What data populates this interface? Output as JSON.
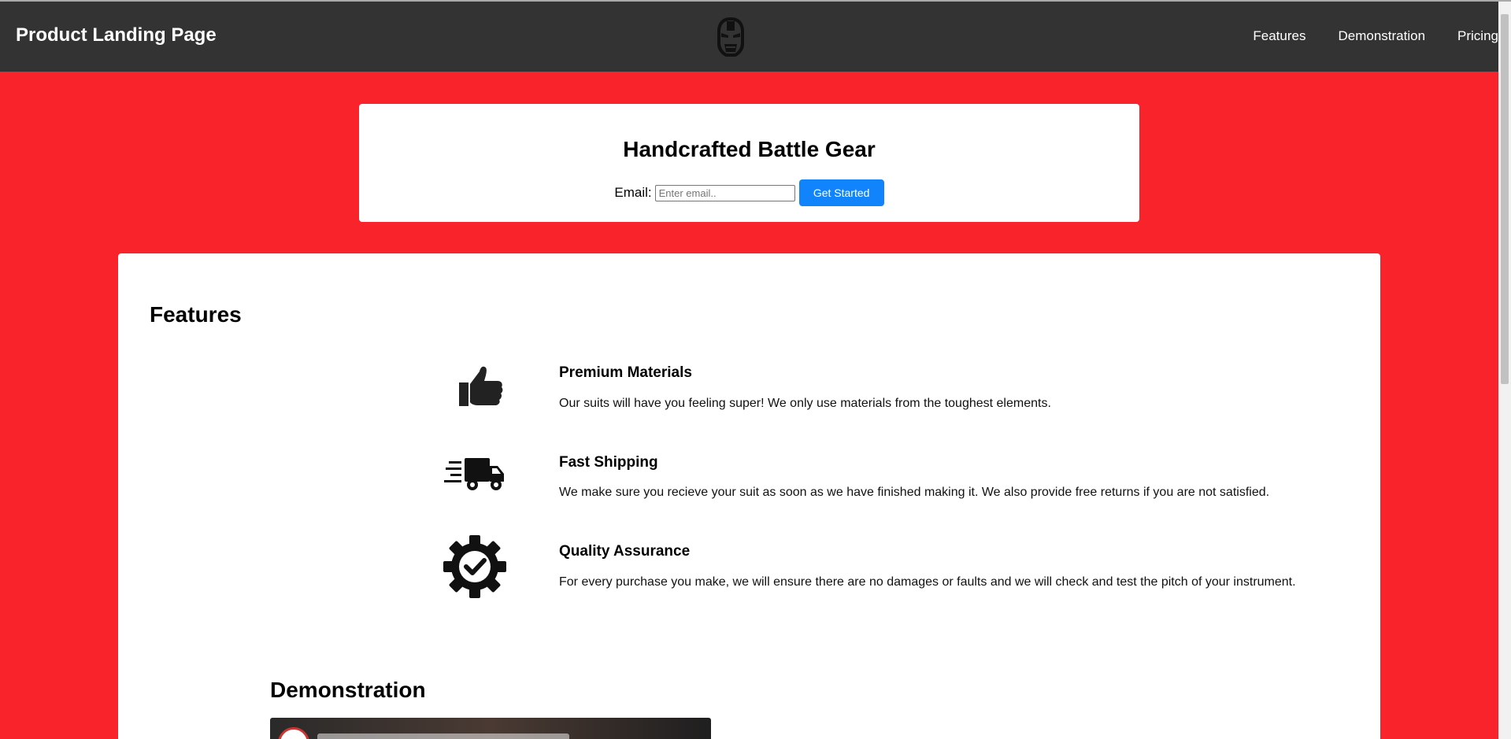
{
  "header": {
    "brand": "Product Landing Page",
    "logo_icon": "iron-man-helmet-icon",
    "nav": [
      {
        "label": "Features"
      },
      {
        "label": "Demonstration"
      },
      {
        "label": "Pricing"
      }
    ]
  },
  "hero": {
    "title": "Handcrafted Battle Gear",
    "email_label": "Email:",
    "email_placeholder": "Enter email..",
    "email_value": "",
    "button_label": "Get Started"
  },
  "features": {
    "title": "Features",
    "items": [
      {
        "icon": "thumbs-up-icon",
        "title": "Premium Materials",
        "text": "Our suits will have you feeling super! We only use materials from the toughest elements."
      },
      {
        "icon": "fast-shipping-truck-icon",
        "title": "Fast Shipping",
        "text": "We make sure you recieve your suit as soon as we have finished making it. We also provide free returns if you are not satisfied."
      },
      {
        "icon": "gear-check-icon",
        "title": "Quality Assurance",
        "text": "For every purchase you make, we will ensure there are no damages or faults and we will check and test the pitch of your instrument."
      }
    ]
  },
  "demonstration": {
    "title": "Demonstration"
  },
  "colors": {
    "background": "#f8232b",
    "header": "#333333",
    "button": "#1184fb"
  }
}
